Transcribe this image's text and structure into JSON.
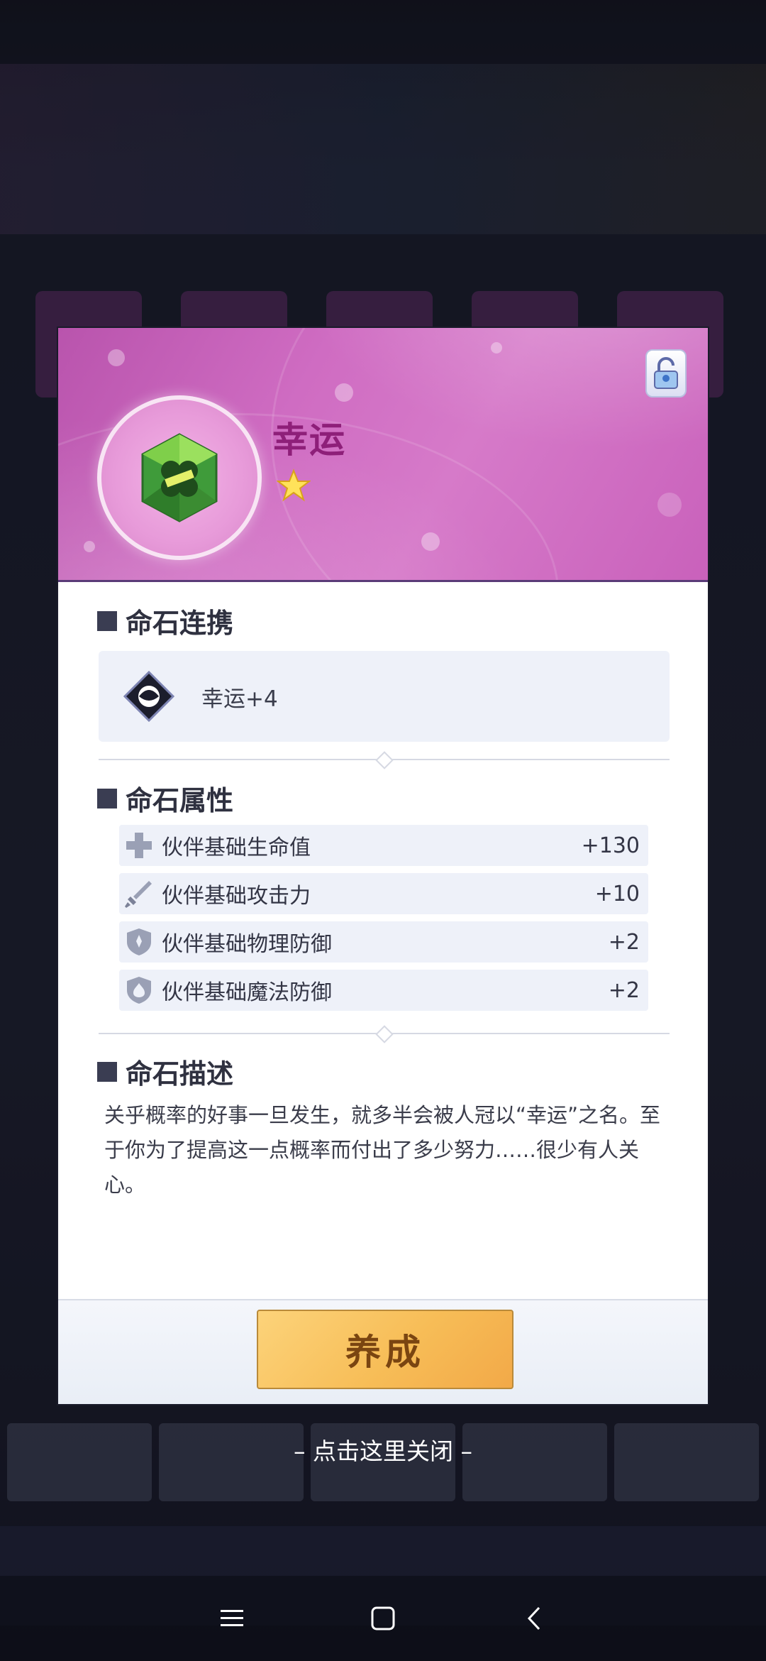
{
  "gem": {
    "name": "幸运",
    "stars": 1
  },
  "sections": {
    "synergy_title": "命石连携",
    "attributes_title": "命石属性",
    "description_title": "命石描述"
  },
  "synergy": {
    "text": "幸运+4"
  },
  "attributes": [
    {
      "label": "伙伴基础生命值",
      "value": "+130",
      "icon": "plus-cross-icon"
    },
    {
      "label": "伙伴基础攻击力",
      "value": "+10",
      "icon": "sword-icon"
    },
    {
      "label": "伙伴基础物理防御",
      "value": "+2",
      "icon": "shield-icon"
    },
    {
      "label": "伙伴基础魔法防御",
      "value": "+2",
      "icon": "magic-shield-icon"
    }
  ],
  "description": "关乎概率的好事一旦发生，就多半会被人冠以“幸运”之名。至于你为了提高这一点概率而付出了多少努力……很少有人关心。",
  "buttons": {
    "train": "养成",
    "close_hint": "– 点击这里关闭 –"
  },
  "colors": {
    "header_bg": "#cf6cc2",
    "title": "#8e1f79",
    "train_button": "#f7bd57"
  }
}
